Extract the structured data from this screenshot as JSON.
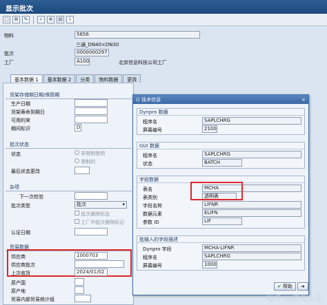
{
  "window": {
    "title": "显示批次"
  },
  "toolbar": {
    "icons": [
      "new-icon",
      "copy-icon",
      "edit-icon",
      "check-icon",
      "lock-icon",
      "page-icon",
      "info-icon"
    ]
  },
  "header": {
    "material_label": "物料",
    "material_value": "5656",
    "material_desc": "三通_DN40×DN30",
    "batch_label": "批次",
    "batch_value": "0000000297",
    "plant_label": "工厂",
    "plant_value": "A100",
    "plant_name": "北京信息科技公司工厂"
  },
  "tabs": [
    "基本数据 1",
    "基本数据 2",
    "分类",
    "物料数据",
    "更改"
  ],
  "shelf_group": {
    "title": "货架存储期日期/保质期",
    "production_date": "生产日期",
    "shelf_expiry": "货架寿命到期日",
    "available": "可用的来",
    "period_indicator": "期间标识",
    "period_value": "D"
  },
  "status_group": {
    "title": "批次状态",
    "status_label": "状态",
    "unrestricted": "非限制使用",
    "restricted": "限制的",
    "last_status_change": "最后状态更改"
  },
  "misc_group": {
    "title": "杂项",
    "next_inspection": "下一次检验",
    "batch_type": "批次类型",
    "batch_type_value": "批次",
    "deletion_flag": "批次删除标志",
    "plant_deletion_flag": "工厂中批次删除标记",
    "cert_date": "认证日期"
  },
  "trade_group": {
    "title": "贸易数据",
    "vendor_label": "供应商",
    "vendor_value": "1000703",
    "vendor_batch_label": "供应商批次",
    "last_gr_label": "上次收货",
    "last_gr_value": "2024/01/02",
    "country_origin": "原产国",
    "region_origin": "原产地",
    "export_group": "贸易内部贸易统计组"
  },
  "dialog": {
    "title": "技术信息",
    "dynpro_group": "Dynpro 数据",
    "program_label": "程序名",
    "program_value": "SAPLCHRG",
    "screen_label": "屏幕编号",
    "screen_value": "2100",
    "gui_group": "GUI 数据",
    "gui_program_label": "程序名",
    "gui_program_value": "SAPLCHRG",
    "gui_status_label": "状态",
    "gui_status_value": "BATCH",
    "field_group": "字段数据",
    "table_label": "表名",
    "table_value": "MCHA",
    "table_type_label": "表类别",
    "table_type_value": "透明表",
    "field_name_label": "字段名称",
    "field_name_value": "LIFNR",
    "data_element_label": "数据元素",
    "data_element_value": "ELIFN",
    "param_label": "参数 ID",
    "param_value": "LIF",
    "input_group": "批输入的字段描述",
    "dynpro_field_label": "Dynpro 字段",
    "dynpro_field_value": "MCHA-LIFNR",
    "program2_label": "程序名",
    "program2_value": "SAPLCHRG",
    "screen2_label": "屏幕编号",
    "screen2_value": "1000",
    "ok_label": "帮助"
  },
  "watermark": "知乎 @西风玄王"
}
